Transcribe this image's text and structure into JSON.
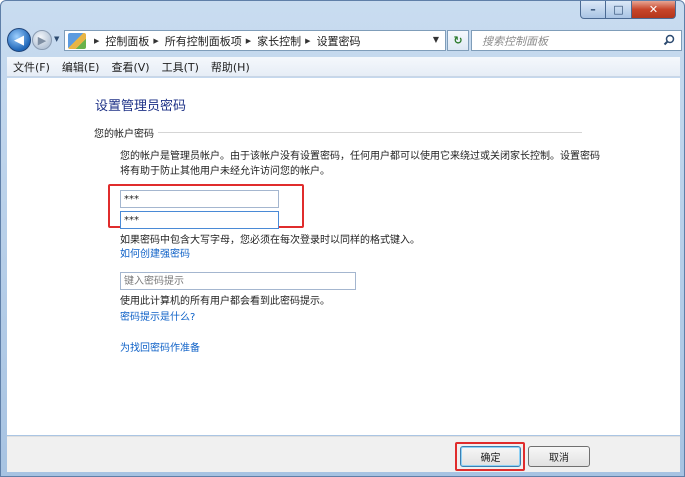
{
  "window": {
    "caption": {
      "minimize": "–",
      "maximize": "□",
      "close": "✕"
    }
  },
  "nav": {
    "back_glyph": "◀",
    "forward_glyph": "▶",
    "breadcrumbs": [
      "控制面板",
      "所有控制面板项",
      "家长控制",
      "设置密码"
    ],
    "refresh_glyph": "↻",
    "search_placeholder": "搜索控制面板"
  },
  "menu": {
    "items": [
      "文件(F)",
      "编辑(E)",
      "查看(V)",
      "工具(T)",
      "帮助(H)"
    ]
  },
  "main": {
    "title": "设置管理员密码",
    "section_label": "您的帐户密码",
    "description": "您的帐户是管理员帐户。由于该帐户没有设置密码，任何用户都可以使用它来绕过或关闭家长控制。设置密码将有助于防止其他用户未经允许访问您的帐户。",
    "password_value": "***",
    "confirm_value": "***",
    "caps_note": "如果密码中包含大写字母，您必须在每次登录时以同样的格式键入。",
    "link_strong_password": "如何创建强密码",
    "hint_placeholder": "键入密码提示",
    "hint_note": "使用此计算机的所有用户都会看到此密码提示。",
    "link_hint_what": "密码提示是什么?",
    "link_reset": "为找回密码作准备"
  },
  "buttons": {
    "ok": "确定",
    "cancel": "取消"
  },
  "colors": {
    "highlight": "#e02c2c",
    "link": "#0d60c7",
    "title": "#1e3287"
  }
}
